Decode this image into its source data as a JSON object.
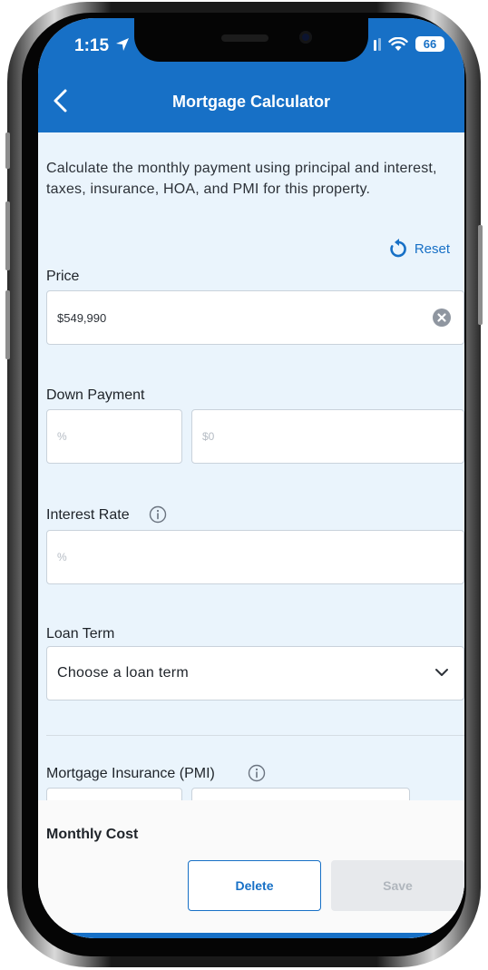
{
  "status_bar": {
    "time": "1:15",
    "battery": "66"
  },
  "header": {
    "title": "Mortgage Calculator"
  },
  "intro": "Calculate the monthly payment using principal and interest, taxes, insurance, HOA, and PMI for this property.",
  "reset_label": "Reset",
  "price": {
    "label": "Price",
    "value": "$549,990"
  },
  "down_payment": {
    "label": "Down Payment",
    "percent_placeholder": "%",
    "amount_placeholder": "$0"
  },
  "interest_rate": {
    "label": "Interest Rate",
    "placeholder": "%"
  },
  "loan_term": {
    "label": "Loan Term",
    "selected": "Choose a loan term"
  },
  "pmi": {
    "label": "Mortgage Insurance (PMI)"
  },
  "footer": {
    "monthly_cost_label": "Monthly Cost",
    "delete_label": "Delete",
    "save_label": "Save"
  },
  "colors": {
    "brand_blue": "#1770c6",
    "page_background": "#eaf4fc"
  }
}
